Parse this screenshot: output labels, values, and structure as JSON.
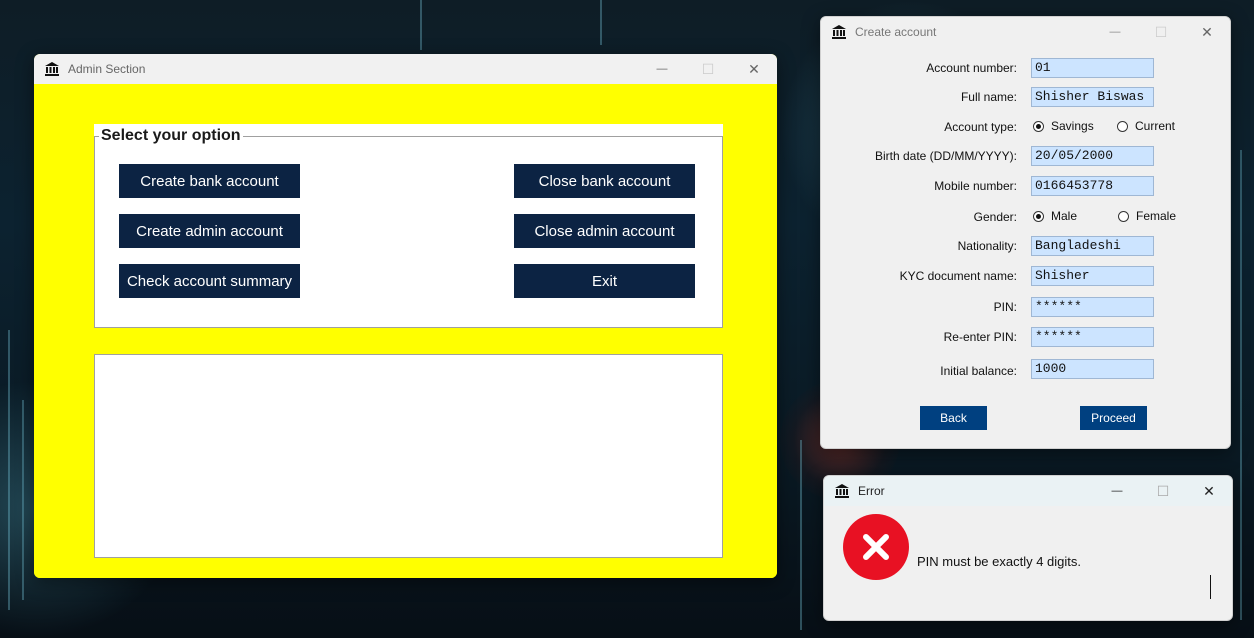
{
  "admin_window": {
    "title": "Admin Section",
    "group_title": "Select your option",
    "buttons": {
      "create_bank": "Create bank account",
      "close_bank": "Close bank account",
      "create_admin": "Create admin account",
      "close_admin": "Close admin account",
      "summary": "Check account summary",
      "exit": "Exit"
    },
    "colors": {
      "background": "#ffff00",
      "button": "#0c2343"
    }
  },
  "create_window": {
    "title": "Create account",
    "fields": {
      "account_number": {
        "label": "Account number:",
        "value": "01"
      },
      "full_name": {
        "label": "Full name:",
        "value": "Shisher Biswas"
      },
      "account_type": {
        "label": "Account type:",
        "options": [
          "Savings",
          "Current"
        ],
        "selected": "Savings"
      },
      "birth_date": {
        "label": "Birth date (DD/MM/YYYY):",
        "value": "20/05/2000"
      },
      "mobile": {
        "label": "Mobile number:",
        "value": "0166453778"
      },
      "gender": {
        "label": "Gender:",
        "options": [
          "Male",
          "Female"
        ],
        "selected": "Male"
      },
      "nationality": {
        "label": "Nationality:",
        "value": "Bangladeshi"
      },
      "kyc": {
        "label": "KYC document name:",
        "value": "Shisher"
      },
      "pin": {
        "label": "PIN:",
        "value": "******"
      },
      "reenter_pin": {
        "label": "Re-enter PIN:",
        "value": "******"
      },
      "initial_balance": {
        "label": "Initial balance:",
        "value": "1000"
      }
    },
    "buttons": {
      "back": "Back",
      "proceed": "Proceed"
    },
    "colors": {
      "field": "#cce4ff",
      "button": "#004080"
    }
  },
  "error_window": {
    "title": "Error",
    "message": "PIN must be exactly 4 digits.",
    "icon": "error-x-icon",
    "colors": {
      "icon": "#e81123"
    }
  },
  "window_controls": {
    "minimize": "—",
    "maximize": "☐",
    "close": "✕"
  }
}
